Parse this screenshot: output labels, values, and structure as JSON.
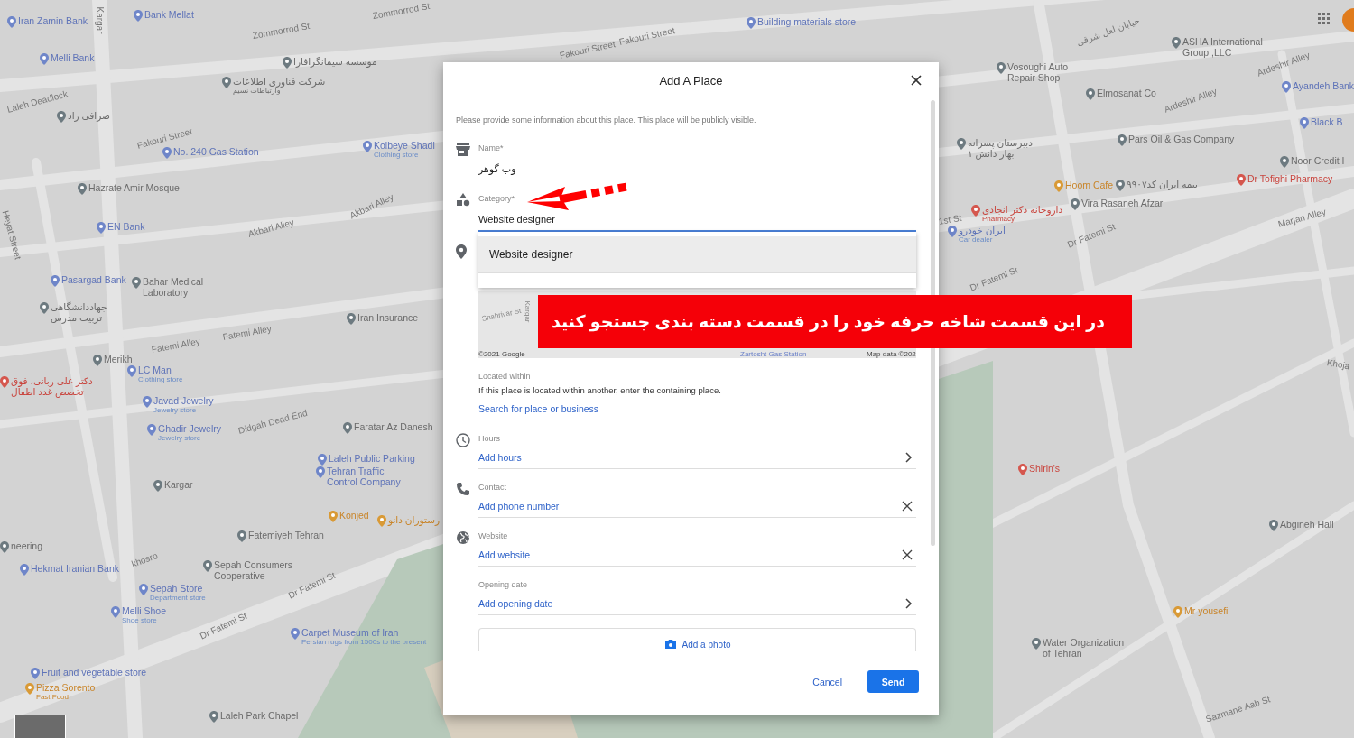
{
  "map": {
    "labels": [
      {
        "kind": "poi",
        "text": "Iran Zamin Bank"
      },
      {
        "kind": "poi",
        "text": "Bank Mellat"
      },
      {
        "kind": "street",
        "text": "Kargar"
      },
      {
        "kind": "street",
        "text": "Zommorrod St"
      },
      {
        "kind": "street",
        "text": "Zommorrod St"
      },
      {
        "kind": "poi",
        "text": "Melli Bank"
      },
      {
        "kind": "place",
        "text": "موسسه سیمانگرافارا"
      },
      {
        "kind": "place",
        "text": "شرکت فناوری اطلاعات",
        "sub": "وارتباطات نسیم"
      },
      {
        "kind": "street",
        "text": "Laleh Deadlock"
      },
      {
        "kind": "place",
        "text": "صرافی راد"
      },
      {
        "kind": "street",
        "text": "Fakouri Street"
      },
      {
        "kind": "poi",
        "text": "No. 240 Gas Station"
      },
      {
        "kind": "poi",
        "text": "Kolbeye Shadi",
        "sub": "Clothing store"
      },
      {
        "kind": "place",
        "text": "Hazrate Amir Mosque"
      },
      {
        "kind": "street",
        "text": "Heyat Street"
      },
      {
        "kind": "poi",
        "text": "EN Bank"
      },
      {
        "kind": "street",
        "text": "Akbari Alley"
      },
      {
        "kind": "street",
        "text": "Akbari Alley"
      },
      {
        "kind": "poi",
        "text": "Pasargad Bank"
      },
      {
        "kind": "place",
        "text": "Bahar Medical Laboratory"
      },
      {
        "kind": "place",
        "text": "جهاددانشگاهی تربیت مدرس"
      },
      {
        "kind": "place",
        "text": "Iran Insurance"
      },
      {
        "kind": "street",
        "text": "Fatemi Alley"
      },
      {
        "kind": "street",
        "text": "Fatemi Alley"
      },
      {
        "kind": "place",
        "text": "Merikh"
      },
      {
        "kind": "poi",
        "text": "LC Man",
        "sub": "Clothing store"
      },
      {
        "kind": "health",
        "text": "دکتر علی ربانی، فوق تخصص غدد اطفال"
      },
      {
        "kind": "poi",
        "text": "Javad Jewelry",
        "sub": "Jewelry store"
      },
      {
        "kind": "poi",
        "text": "Ghadir Jewelry",
        "sub": "Jewelry store"
      },
      {
        "kind": "street",
        "text": "Didgah Dead End"
      },
      {
        "kind": "place",
        "text": "Faratar Az Danesh"
      },
      {
        "kind": "poi",
        "text": "Laleh Public Parking"
      },
      {
        "kind": "place",
        "text": "Kargar"
      },
      {
        "kind": "poi",
        "text": "Tehran Traffic Control Company"
      },
      {
        "kind": "food",
        "text": "Konjed"
      },
      {
        "kind": "food",
        "text": "رستوران دانو"
      },
      {
        "kind": "place",
        "text": "Fatemiyeh Tehran"
      },
      {
        "kind": "place",
        "text": "neering"
      },
      {
        "kind": "poi",
        "text": "Hekmat Iranian Bank"
      },
      {
        "kind": "street",
        "text": "khosro"
      },
      {
        "kind": "poi",
        "text": "Sepah Store",
        "sub": "Department store"
      },
      {
        "kind": "place",
        "text": "Sepah Consumers Cooperative"
      },
      {
        "kind": "street",
        "text": "Dr Fatemi St"
      },
      {
        "kind": "poi",
        "text": "Melli Shoe",
        "sub": "Shoe store"
      },
      {
        "kind": "street",
        "text": "Dr Fatemi St"
      },
      {
        "kind": "poi",
        "text": "Carpet Museum of Iran",
        "sub": "Persian rugs from 1500s to the present"
      },
      {
        "kind": "poi",
        "text": "Fruit and vegetable store"
      },
      {
        "kind": "food",
        "text": "Pizza Sorento",
        "sub": "Fast Food"
      },
      {
        "kind": "place",
        "text": "Laleh Park Chapel"
      },
      {
        "kind": "street",
        "text": "Fakouri Street"
      },
      {
        "kind": "street",
        "text": "Fakouri Street"
      },
      {
        "kind": "poi",
        "text": "Building materials store"
      },
      {
        "kind": "street",
        "text": "خیابان لعل شرقی"
      },
      {
        "kind": "place",
        "text": "ASHA International Group ,LLC"
      },
      {
        "kind": "place",
        "text": "Vosoughi Auto Repair Shop"
      },
      {
        "kind": "street",
        "text": "Ardeshir Alley"
      },
      {
        "kind": "place",
        "text": "Elmosanat Co"
      },
      {
        "kind": "street",
        "text": "Ardeshir Alley"
      },
      {
        "kind": "poi",
        "text": "Ayandeh Bank"
      },
      {
        "kind": "poi",
        "text": "Black B"
      },
      {
        "kind": "place",
        "text": "دبیرستان پسرانه بهار دانش ۱"
      },
      {
        "kind": "place",
        "text": "Pars Oil & Gas Company"
      },
      {
        "kind": "place",
        "text": "Noor Credit I"
      },
      {
        "kind": "food",
        "text": "Hoom Cafe"
      },
      {
        "kind": "place",
        "text": "بیمه ایران کد۹۹۰۷"
      },
      {
        "kind": "health",
        "text": "Dr Tofighi Pharmacy"
      },
      {
        "kind": "street",
        "text": "1st St"
      },
      {
        "kind": "health",
        "text": "داروخانه دکتر انجادی",
        "sub": "Pharmacy"
      },
      {
        "kind": "place",
        "text": "Vira Rasaneh Afzar"
      },
      {
        "kind": "street",
        "text": "Marjan Alley"
      },
      {
        "kind": "poi",
        "text": "ایران خودرو",
        "sub": "Car dealer"
      },
      {
        "kind": "street",
        "text": "Dr Fatemi St"
      },
      {
        "kind": "street",
        "text": "Dr Fatemi St"
      },
      {
        "kind": "street",
        "text": "Khoja"
      },
      {
        "kind": "health",
        "text": "Shirin's"
      },
      {
        "kind": "place",
        "text": "Abgineh Hall"
      },
      {
        "kind": "food",
        "text": "Mr yousefi"
      },
      {
        "kind": "place",
        "text": "Water Organization of Tehran"
      },
      {
        "kind": "street",
        "text": "Sazmane Aab St"
      }
    ]
  },
  "dialog": {
    "title": "Add A Place",
    "intro": "Please provide some information about this place. This place will be publicly visible.",
    "name_field": {
      "label": "Name*",
      "value": "وب گوهر"
    },
    "category_field": {
      "label": "Category*",
      "value": "Website designer",
      "focused": true
    },
    "suggestions": [
      {
        "text": "Website designer",
        "selected": true
      }
    ],
    "mini_map": {
      "labels": [
        "Shahrivar St",
        "Kargar",
        "©2021 Google",
        "Zartosht Gas Station",
        "Map data ©202"
      ]
    },
    "located_within": {
      "label": "Located within",
      "hint": "If this place is located within another, enter the containing place.",
      "link": "Search for place or business"
    },
    "rows": [
      {
        "kind": "chevron",
        "label": "Hours",
        "link": "Add hours"
      },
      {
        "kind": "clear",
        "label": "Contact",
        "link": "Add phone number"
      },
      {
        "kind": "clear",
        "label": "Website",
        "link": "Add website"
      },
      {
        "kind": "chevron",
        "label": "Opening date",
        "link": "Add opening date"
      }
    ],
    "photo_button": "Add a photo",
    "buttons": {
      "cancel": "Cancel",
      "send": "Send"
    }
  },
  "annotation": {
    "banner": "در این قسمت شاخه حرفه خود را در قسمت دسته بندی جستجو کنید"
  }
}
